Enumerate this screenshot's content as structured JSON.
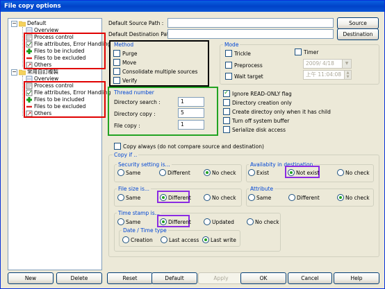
{
  "window": {
    "title": "File copy options"
  },
  "tree": {
    "groups": [
      {
        "label": "Default",
        "items": [
          "Overview",
          "Process control",
          "File attributes, Error Handling",
          "Files to be included",
          "Files to be excluded",
          "Others"
        ]
      },
      {
        "label": "常用自訂複製",
        "items": [
          "Overview",
          "Process control",
          "File attributes, Error Handling",
          "Files to be included",
          "Files to be excluded",
          "Others"
        ]
      }
    ]
  },
  "paths": {
    "source_label": "Default Source Path :",
    "source_value": "",
    "source_button": "Source",
    "dest_label": "Default Destination Path :",
    "dest_value": "",
    "dest_button": "Destination"
  },
  "method": {
    "title": "Method",
    "options": [
      {
        "label": "Purge",
        "checked": false
      },
      {
        "label": "Move",
        "checked": false
      },
      {
        "label": "Consolidate multiple sources",
        "checked": false
      },
      {
        "label": "Verify",
        "checked": false
      }
    ]
  },
  "mode": {
    "title": "Mode",
    "trickle": "Trickle",
    "timer": "Timer",
    "preprocess": "Preprocess",
    "date_value": "2009/ 4/18",
    "wait_target": "Wait target",
    "time_value": "上午 11:04:08"
  },
  "thread": {
    "title": "Thread number",
    "directory_search_label": "Directory search :",
    "directory_search_value": "1",
    "directory_copy_label": "Directory copy :",
    "directory_copy_value": "5",
    "file_copy_label": "File copy :",
    "file_copy_value": "1"
  },
  "flags": [
    {
      "label": "Ignore READ-ONLY flag",
      "checked": true
    },
    {
      "label": "Directory creation only",
      "checked": false
    },
    {
      "label": "Create directoy only when it has child",
      "checked": false
    },
    {
      "label": "Turn off system buffer",
      "checked": false
    },
    {
      "label": "Serialize disk access",
      "checked": false
    }
  ],
  "copy_always": {
    "label": "Copy always (do not compare source and destination)",
    "checked": false
  },
  "copy_if": {
    "title": "Copy if ..",
    "security": {
      "title": "Security setting is...",
      "options": [
        "Same",
        "Different",
        "No check"
      ],
      "selected": "No check"
    },
    "availability": {
      "title": "Availabity in destination",
      "options": [
        "Exist",
        "Not exist",
        "No check"
      ],
      "selected": "Not exist"
    },
    "file_size": {
      "title": "File size is...",
      "options": [
        "Same",
        "Different",
        "No check"
      ],
      "selected": "Different"
    },
    "attribute": {
      "title": "Attribute",
      "options": [
        "Same",
        "Different",
        "No check"
      ],
      "selected": "No check"
    },
    "time_stamp": {
      "title": "Time stamp is...",
      "options": [
        "Same",
        "Different",
        "Updated",
        "No check"
      ],
      "selected": "Different"
    },
    "date_time_type": {
      "title": "Date / Time type",
      "options": [
        "Creation",
        "Last access",
        "Last write"
      ],
      "selected": "Last write"
    }
  },
  "buttons": {
    "new": "New",
    "delete": "Delete",
    "reset": "Reset",
    "default": "Default",
    "apply": "Apply",
    "ok": "OK",
    "cancel": "Cancel",
    "help": "Help"
  }
}
